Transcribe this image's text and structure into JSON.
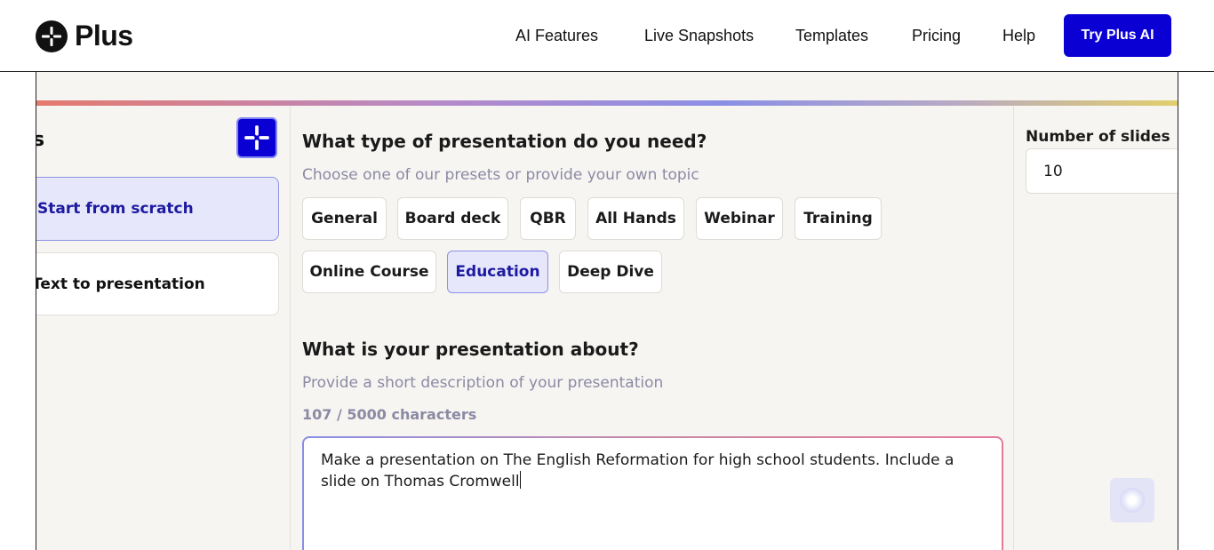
{
  "nav": {
    "logo_text": "Plus",
    "links": [
      "AI Features",
      "Live Snapshots",
      "Templates",
      "Pricing",
      "Help"
    ],
    "cta": "Try Plus AI"
  },
  "left": {
    "title_fragment": "s",
    "options": [
      "Start from scratch",
      "Text to presentation"
    ]
  },
  "main": {
    "type_heading": "What type of presentation do you need?",
    "type_sub": "Choose one of our presets or provide your own topic",
    "chips_row1": [
      "General",
      "Board deck",
      "QBR",
      "All Hands",
      "Webinar",
      "Training"
    ],
    "chips_row2": [
      "Online Course",
      "Education",
      "Deep Dive"
    ],
    "selected_chip": "Education",
    "about_heading": "What is your presentation about?",
    "about_sub": "Provide a short description of your presentation",
    "char_count": "107 / 5000 characters",
    "description": "Make a presentation on The English Reformation for high school students. Include a slide on Thomas Cromwell"
  },
  "right": {
    "slides_label": "Number of slides",
    "slides_value": "10"
  },
  "colors": {
    "accent": "#0b00d4",
    "selected_bg": "#e6e7fb",
    "selected_text": "#1d1aa0"
  }
}
